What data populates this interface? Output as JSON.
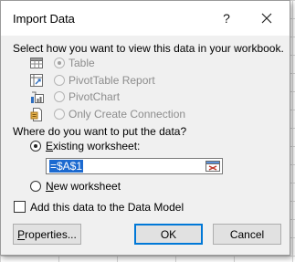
{
  "dialog": {
    "title": "Import Data",
    "help_glyph": "?",
    "close_glyph": "✕"
  },
  "view_section": {
    "heading": "Select how you want to view this data in your workbook.",
    "options": [
      {
        "label": "Table",
        "icon": "table-icon",
        "selected": true,
        "enabled": false
      },
      {
        "label": "PivotTable Report",
        "icon": "pivottable-icon",
        "selected": false,
        "enabled": false
      },
      {
        "label": "PivotChart",
        "icon": "pivotchart-icon",
        "selected": false,
        "enabled": false
      },
      {
        "label": "Only Create Connection",
        "icon": "connection-icon",
        "selected": false,
        "enabled": false
      }
    ]
  },
  "location_section": {
    "heading": "Where do you want to put the data?",
    "existing_label_prefix": "E",
    "existing_label_rest": "xisting worksheet:",
    "existing_selected": true,
    "reference_value": "=$A$1",
    "new_label_prefix": "N",
    "new_label_rest": "ew worksheet",
    "new_selected": false
  },
  "data_model": {
    "label": "Add this data to the Data Model",
    "checked": false
  },
  "buttons": {
    "properties_prefix": "P",
    "properties_rest": "roperties...",
    "ok": "OK",
    "cancel": "Cancel"
  },
  "colors": {
    "dialog_bg": "#f0f0f0",
    "selection_blue": "#1c6ad0",
    "default_button_border": "#0078d7",
    "disabled_text": "#8d8d8d"
  }
}
